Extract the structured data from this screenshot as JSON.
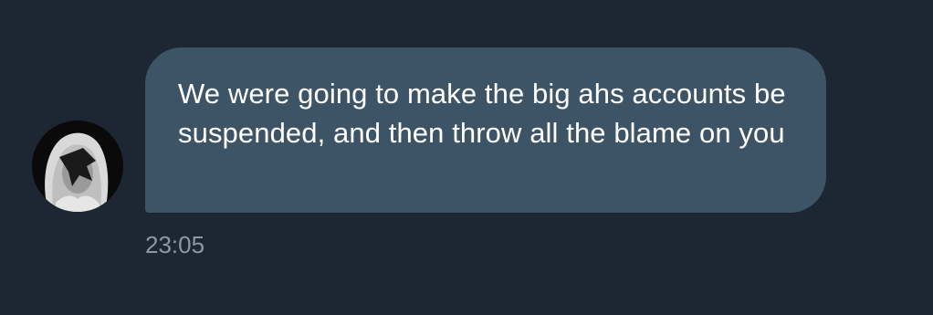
{
  "conversation": {
    "messages": [
      {
        "text": "We were going to make the big ahs accounts be suspended, and then throw all the blame on you",
        "time": "23:05"
      }
    ]
  },
  "colors": {
    "background": "#1c2733",
    "bubble": "#3d5466",
    "message_text": "#ffffff",
    "timestamp": "#8899a6"
  }
}
